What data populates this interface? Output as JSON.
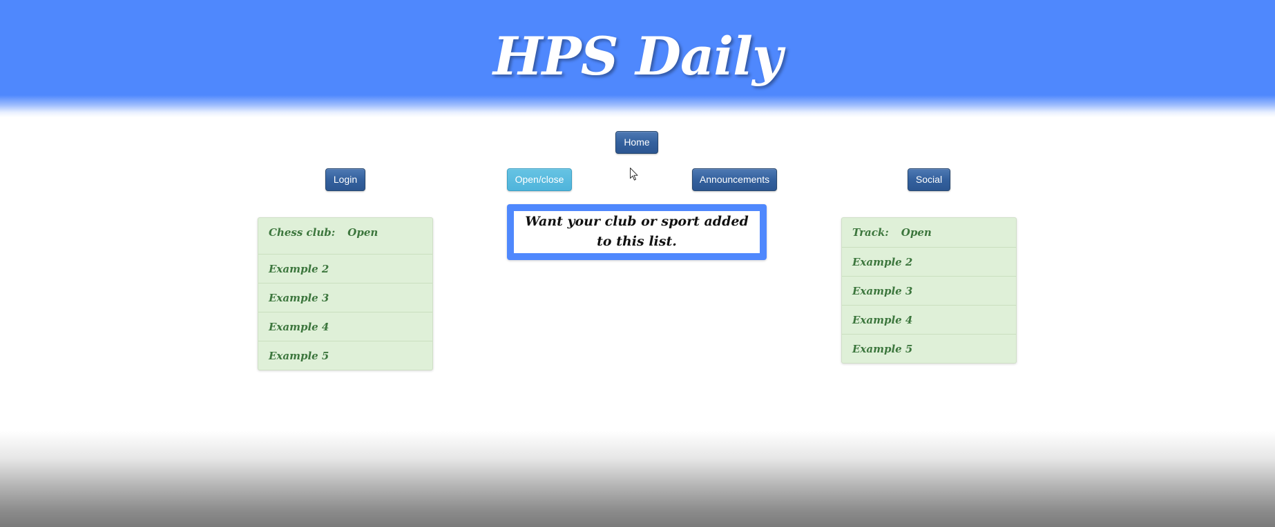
{
  "header": {
    "title": "HPS Daily"
  },
  "nav": {
    "home": "Home",
    "login": "Login",
    "open_close": "Open/close",
    "announcements": "Announcements",
    "social": "Social"
  },
  "left_list": {
    "items": [
      {
        "label": "Chess club:",
        "status": "Open"
      },
      {
        "label": "Example 2"
      },
      {
        "label": "Example 3"
      },
      {
        "label": "Example 4"
      },
      {
        "label": "Example 5"
      }
    ]
  },
  "center_notice": {
    "text": "Want your club or sport added to this list."
  },
  "right_list": {
    "items": [
      {
        "label": "Track:",
        "status": "Open"
      },
      {
        "label": "Example 2"
      },
      {
        "label": "Example 3"
      },
      {
        "label": "Example 4"
      },
      {
        "label": "Example 5"
      }
    ]
  },
  "colors": {
    "header_blue": "#4f88fd",
    "button_dark": "#34619e",
    "button_info": "#5bc0de",
    "list_bg": "#dff0d8",
    "list_text": "#3c763d"
  },
  "icons": {
    "cursor": "mouse-pointer-icon"
  }
}
